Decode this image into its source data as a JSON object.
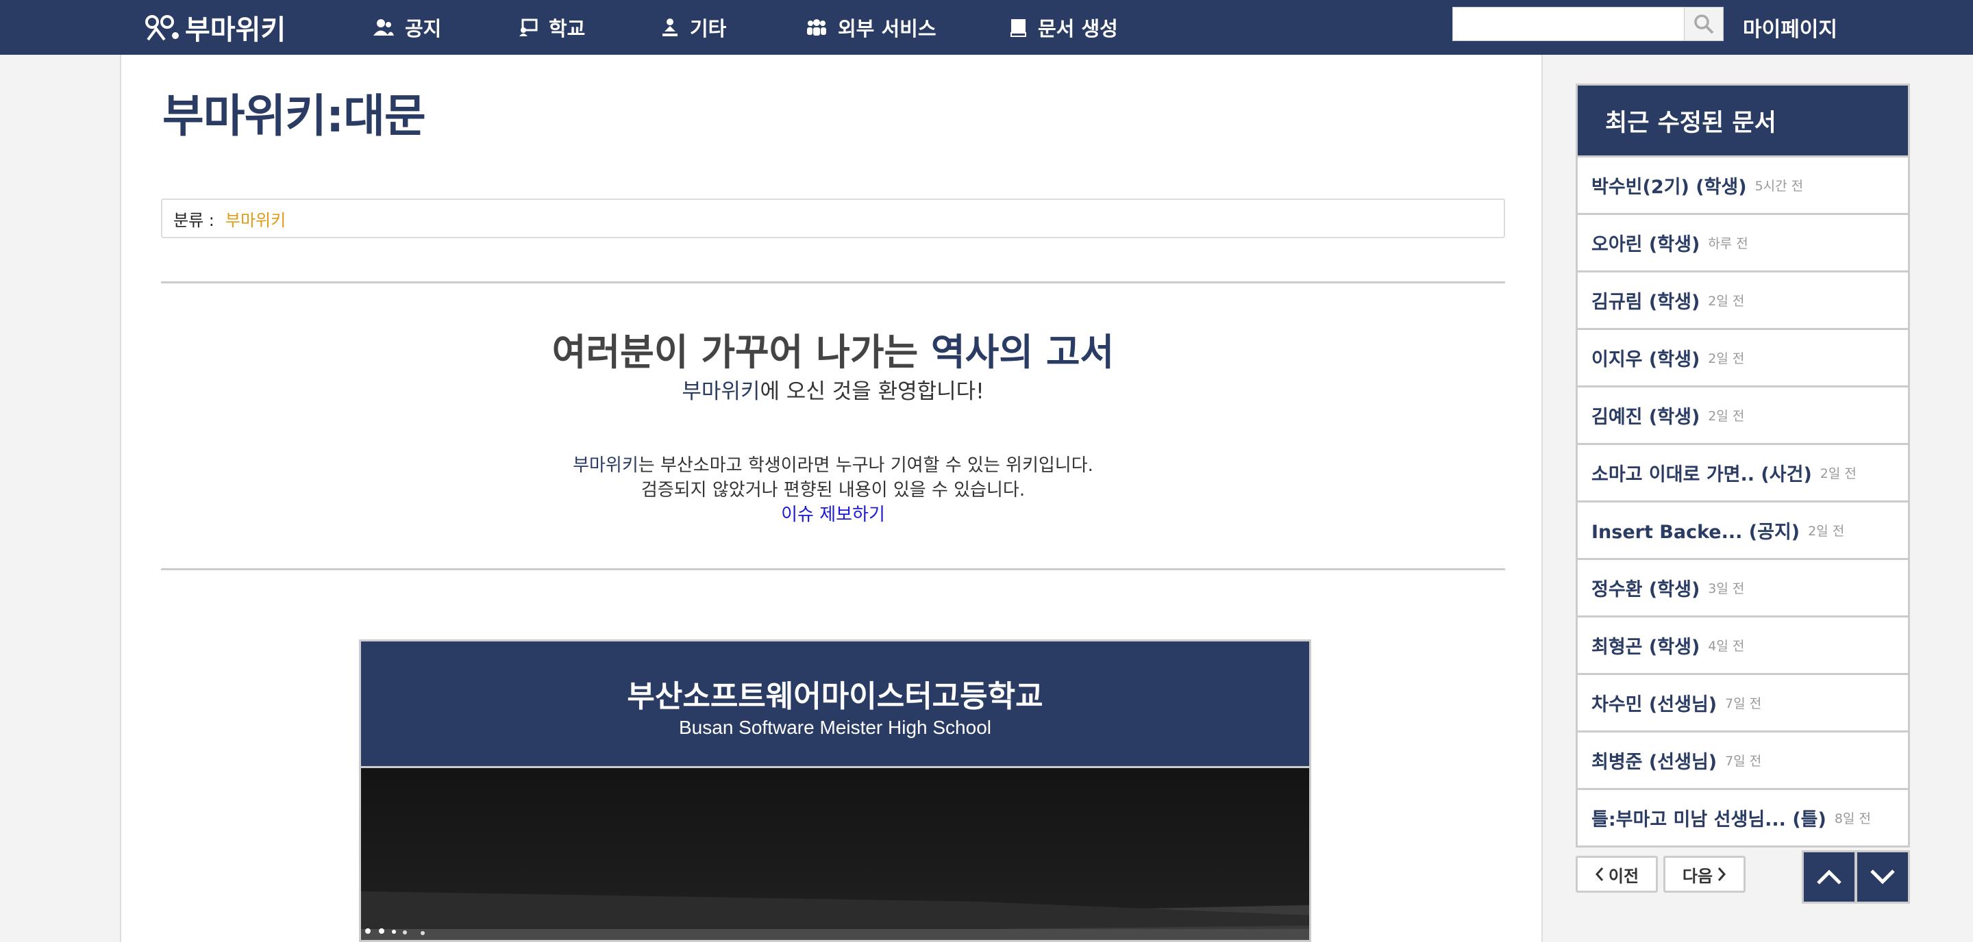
{
  "header": {
    "logo_text": "부마위키",
    "nav": [
      {
        "label": "공지",
        "icon": "users-icon"
      },
      {
        "label": "학교",
        "icon": "school-icon"
      },
      {
        "label": "기타",
        "icon": "person-icon"
      },
      {
        "label": "외부 서비스",
        "icon": "group-icon"
      },
      {
        "label": "문서 생성",
        "icon": "book-icon"
      }
    ],
    "search": {
      "value": "",
      "placeholder": ""
    },
    "mypage_label": "마이페이지"
  },
  "main": {
    "page_title": "부마위키:대문",
    "category": {
      "label": "분류 :",
      "value": "부마위키"
    },
    "hero": {
      "title_plain": "여러분이 가꾸어 나가는 ",
      "title_accent": "역사의 고서",
      "sub_accent": "부마위키",
      "sub_rest": "에 오신 것을 환영합니다!",
      "desc_accent": "부마위키",
      "desc_line1_rest": "는 부산소마고 학생이라면 누구나 기여할 수 있는 위키입니다.",
      "desc_line2": "검증되지 않았거나 편향된 내용이 있을 수 있습니다.",
      "report_link": "이슈 제보하기"
    },
    "school": {
      "name_ko": "부산소프트웨어마이스터고등학교",
      "name_en": "Busan Software Meister High School"
    }
  },
  "sidebar": {
    "title": "최근 수정된 문서",
    "items": [
      {
        "title": "박수빈(2기) (학생)",
        "time": "5시간 전"
      },
      {
        "title": "오아린 (학생)",
        "time": "하루 전"
      },
      {
        "title": "김규림 (학생)",
        "time": "2일 전"
      },
      {
        "title": "이지우 (학생)",
        "time": "2일 전"
      },
      {
        "title": "김예진 (학생)",
        "time": "2일 전"
      },
      {
        "title": "소마고 이대로 가면.. (사건)",
        "time": "2일 전"
      },
      {
        "title": "Insert Backe... (공지)",
        "time": "2일 전"
      },
      {
        "title": "정수환 (학생)",
        "time": "3일 전"
      },
      {
        "title": "최형곤 (학생)",
        "time": "4일 전"
      },
      {
        "title": "차수민 (선생님)",
        "time": "7일 전"
      },
      {
        "title": "최병준 (선생님)",
        "time": "7일 전"
      },
      {
        "title": "틀:부마고 미남 선생님... (틀)",
        "time": "8일 전"
      }
    ],
    "prev_label": "이전",
    "next_label": "다음"
  },
  "colors": {
    "brand_navy": "#2a3c64",
    "category_link": "#e39b16",
    "link_blue": "#1a1ad6"
  }
}
